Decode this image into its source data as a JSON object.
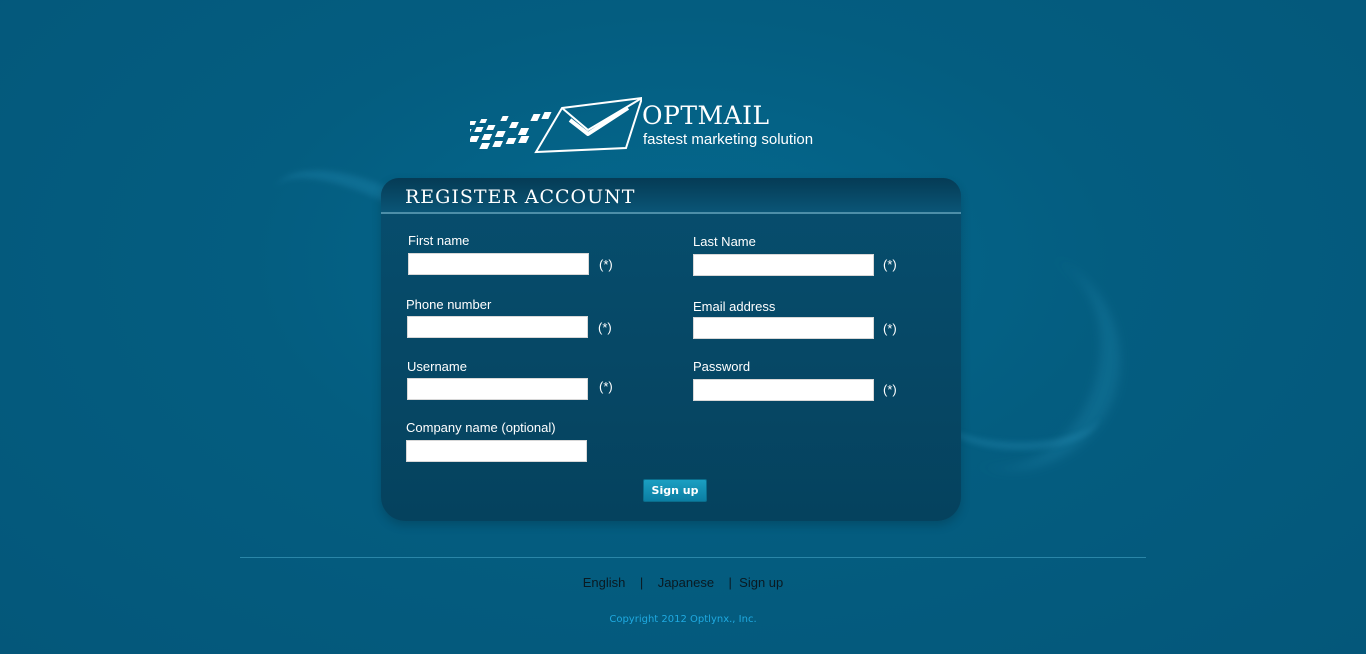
{
  "logo": {
    "name": "OPTMAIL",
    "tagline": "fastest marketing solution"
  },
  "form": {
    "title": "REGISTER  ACCOUNT",
    "required_marker": "(*)",
    "fields": {
      "first_name": {
        "label": "First name",
        "value": ""
      },
      "last_name": {
        "label": "Last Name",
        "value": ""
      },
      "phone": {
        "label": "Phone number",
        "value": ""
      },
      "email": {
        "label": "Email address",
        "value": ""
      },
      "username": {
        "label": "Username",
        "value": ""
      },
      "password": {
        "label": "Password",
        "value": ""
      },
      "company": {
        "label": "Company name (optional)",
        "value": ""
      }
    },
    "submit_label": "Sign up"
  },
  "footer": {
    "links": [
      "English",
      "Japanese",
      "Sign up"
    ],
    "separator": "|",
    "copyright": "Copyright 2012 Optlynx., Inc."
  },
  "colors": {
    "background": "#045a7c",
    "panel": "#064a68",
    "button": "#1490b6",
    "copyright": "#1fa9e0"
  }
}
